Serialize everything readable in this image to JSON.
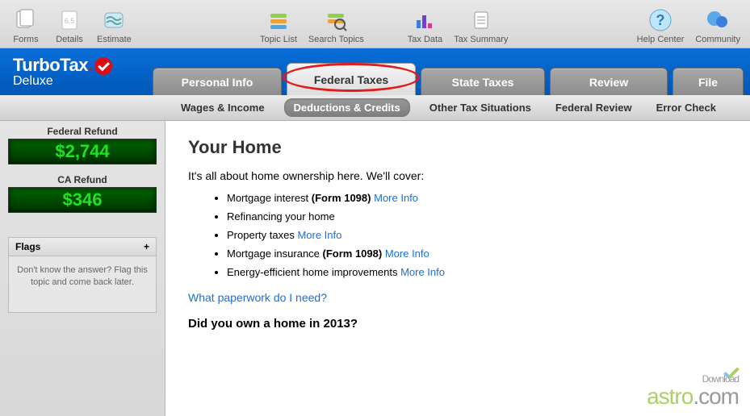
{
  "toolbar": {
    "left": [
      {
        "label": "Forms",
        "icon": "forms"
      },
      {
        "label": "Details",
        "icon": "details"
      },
      {
        "label": "Estimate",
        "icon": "estimate"
      }
    ],
    "center": [
      {
        "label": "Topic List",
        "icon": "topic-list"
      },
      {
        "label": "Search Topics",
        "icon": "search"
      },
      {
        "label": "Tax Data",
        "icon": "bar-chart"
      },
      {
        "label": "Tax Summary",
        "icon": "summary"
      }
    ],
    "right": [
      {
        "label": "Help Center",
        "icon": "help"
      },
      {
        "label": "Community",
        "icon": "community"
      }
    ]
  },
  "brand": {
    "name": "TurboTax",
    "edition": "Deluxe"
  },
  "main_tabs": [
    {
      "label": "Personal Info"
    },
    {
      "label": "Federal Taxes",
      "active": true,
      "highlighted": true
    },
    {
      "label": "State Taxes"
    },
    {
      "label": "Review"
    },
    {
      "label": "File"
    }
  ],
  "sub_tabs": [
    {
      "label": "Wages & Income"
    },
    {
      "label": "Deductions & Credits",
      "active": true
    },
    {
      "label": "Other Tax Situations"
    },
    {
      "label": "Federal Review"
    },
    {
      "label": "Error Check"
    }
  ],
  "refunds": [
    {
      "label": "Federal Refund",
      "value": "$2,744"
    },
    {
      "label": "CA Refund",
      "value": "$346"
    }
  ],
  "flags": {
    "title": "Flags",
    "expand": "+",
    "body": "Don't know the answer? Flag this topic and come back later."
  },
  "page": {
    "heading": "Your Home",
    "intro": "It's all about home ownership here. We'll cover:",
    "bullets": [
      {
        "text": "Mortgage interest ",
        "bold": "(Form 1098)",
        "link": "More Info"
      },
      {
        "text": "Refinancing your home"
      },
      {
        "text": "Property taxes ",
        "link": "More Info"
      },
      {
        "text": "Mortgage insurance ",
        "bold": "(Form 1098)",
        "link": "More Info"
      },
      {
        "text": "Energy-efficient home improvements ",
        "link": "More Info"
      }
    ],
    "paperwork_link": "What paperwork do I need?",
    "question": "Did you own a home in 2013?"
  },
  "watermark": {
    "top": "Download",
    "main": "astro",
    "suffix": ".com"
  }
}
